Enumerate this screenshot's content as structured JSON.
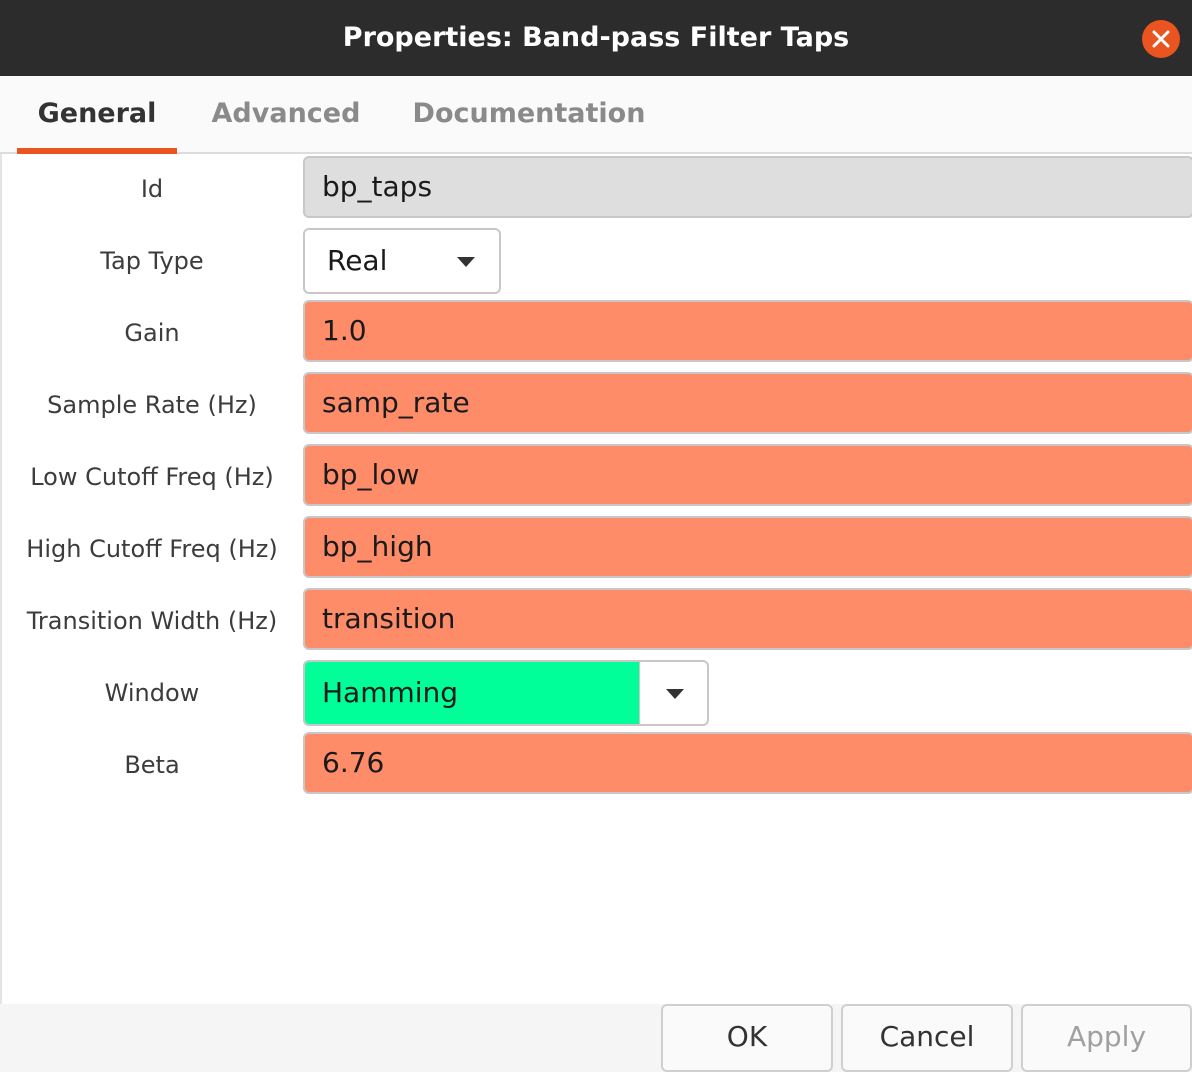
{
  "window": {
    "title": "Properties: Band-pass Filter Taps"
  },
  "tabs": [
    {
      "label": "General",
      "active": true
    },
    {
      "label": "Advanced",
      "active": false
    },
    {
      "label": "Documentation",
      "active": false
    }
  ],
  "fields": {
    "id": {
      "label": "Id",
      "value": "bp_taps"
    },
    "tap_type": {
      "label": "Tap Type",
      "value": "Real"
    },
    "gain": {
      "label": "Gain",
      "value": "1.0"
    },
    "sample_rate": {
      "label": "Sample Rate (Hz)",
      "value": "samp_rate"
    },
    "low_cutoff": {
      "label": "Low Cutoff Freq (Hz)",
      "value": "bp_low"
    },
    "high_cutoff": {
      "label": "High Cutoff Freq (Hz)",
      "value": "bp_high"
    },
    "transition": {
      "label": "Transition Width (Hz)",
      "value": "transition"
    },
    "window": {
      "label": "Window",
      "value": "Hamming"
    },
    "beta": {
      "label": "Beta",
      "value": "6.76"
    }
  },
  "buttons": {
    "ok": "OK",
    "cancel": "Cancel",
    "apply": "Apply"
  },
  "colors": {
    "accent": "#e95420",
    "error_field": "#ff8c69",
    "ok_field": "#00ff99",
    "readonly_field": "#dedede"
  }
}
